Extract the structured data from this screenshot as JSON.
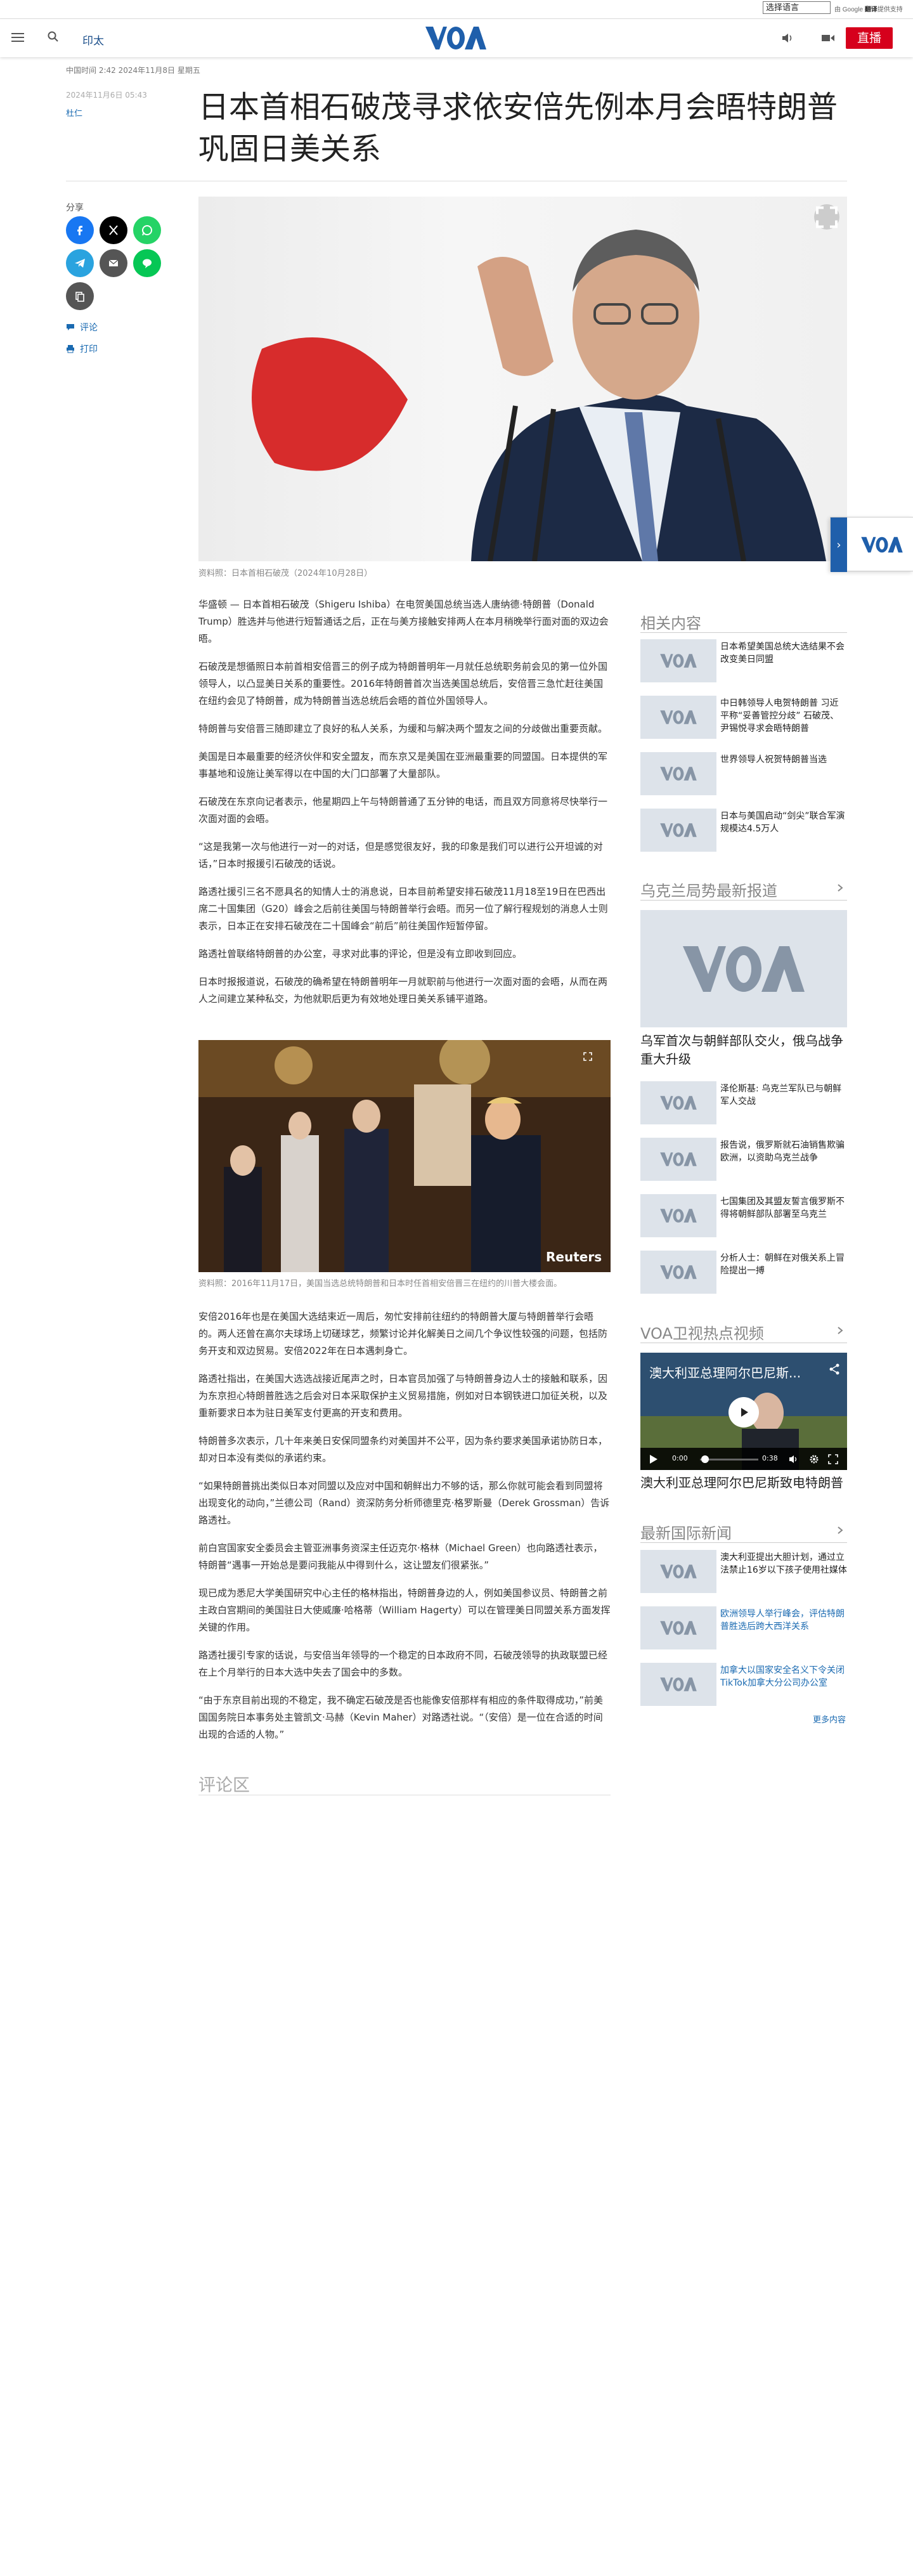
{
  "translate": {
    "select_label": "选择语言",
    "powered_prefix": "由",
    "powered_google": "Google",
    "powered_suffix": "翻译",
    "powered_tail": "提供支持"
  },
  "header": {
    "print_label": "印太",
    "live_label": "直播",
    "logo_text": "VOA"
  },
  "article": {
    "published": "中国时间 2:42 2024年11月8日 星期五",
    "posted": "2024年11月6日 05:43",
    "author": "杜仁",
    "title": "日本首相石破茂寻求依安倍先例本月会晤特朗普巩固日美关系",
    "share_label": "分享",
    "comments_link": "评论",
    "print_link": "打印",
    "hero_caption": "资料照：日本首相石破茂（2024年10月28日）",
    "paragraphs_a": [
      "华盛顿 — 日本首相石破茂（Shigeru Ishiba）在电贺美国总统当选人唐纳德·特朗普（Donald Trump）胜选并与他进行短暂通话之后，正在与美方接触安排两人在本月稍晚举行面对面的双边会晤。",
      "石破茂是想循照日本前首相安倍晋三的例子成为特朗普明年一月就任总统职务前会见的第一位外国领导人，以凸显美日关系的重要性。2016年特朗普首次当选美国总统后，安倍晋三急忙赶往美国在纽约会见了特朗普，成为特朗普当选总统后会晤的首位外国领导人。",
      "特朗普与安倍晋三随即建立了良好的私人关系，为缓和与解决两个盟友之间的分歧做出重要贡献。",
      "美国是日本最重要的经济伙伴和安全盟友，而东京又是美国在亚洲最重要的同盟国。日本提供的军事基地和设施让美军得以在中国的大门口部署了大量部队。",
      "石破茂在东京向记者表示，他星期四上午与特朗普通了五分钟的电话，而且双方同意将尽快举行一次面对面的会晤。",
      "“这是我第一次与他进行一对一的对话，但是感觉很友好，我的印象是我们可以进行公开坦诚的对话，”日本时报援引石破茂的话说。",
      "路透社援引三名不愿具名的知情人士的消息说，日本目前希望安排石破茂11月18至19日在巴西出席二十国集团（G20）峰会之后前往美国与特朗普举行会晤。而另一位了解行程规划的消息人士则表示，日本正在安排石破茂在二十国峰会“前后”前往美国作短暂停留。",
      "路透社曾联络特朗普的办公室，寻求对此事的评论，但是没有立即收到回应。",
      "日本时报报道说，石破茂的确希望在特朗普明年一月就职前与他进行一次面对面的会晤，从而在两人之间建立某种私交，为他就职后更为有效地处理日美关系铺平道路。"
    ],
    "inline_caption": "资料照：2016年11月17日，美国当选总统特朗普和日本时任首相安倍晋三在纽约的川普大楼会面。",
    "inline_watermark": "Reuters",
    "paragraphs_b": [
      "安倍2016年也是在美国大选结束近一周后，匆忙安排前往纽约的特朗普大厦与特朗普举行会晤的。两人还曾在高尔夫球场上切磋球艺，频繁讨论并化解美日之间几个争议性较强的问题，包括防务开支和双边贸易。安倍2022年在日本遇刺身亡。",
      "路透社指出，在美国大选选战接近尾声之时，日本官员加强了与特朗普身边人士的接触和联系，因为东京担心特朗普胜选之后会对日本采取保护主义贸易措施，例如对日本钢铁进口加征关税，以及重新要求日本为驻日美军支付更高的开支和费用。",
      "特朗普多次表示，几十年来美日安保同盟条约对美国并不公平，因为条约要求美国承诺协防日本，却对日本没有类似的承诺约束。",
      "“如果特朗普挑出类似日本对同盟以及应对中国和朝鲜出力不够的话，那么你就可能会看到同盟将出现变化的动向，”兰德公司（Rand）资深防务分析师德里克·格罗斯曼（Derek Grossman）告诉路透社。",
      "前白宫国家安全委员会主管亚洲事务资深主任迈克尔·格林（Michael Green）也向路透社表示，特朗普“遇事一开始总是要问我能从中得到什么，这让盟友们很紧张。”",
      "现已成为悉尼大学美国研究中心主任的格林指出，特朗普身边的人，例如美国参议员、特朗普之前主政白宫期间的美国驻日大使威廉·哈格蒂（William Hagerty）可以在管理美日同盟关系方面发挥关键的作用。",
      "路透社援引专家的话说，与安倍当年领导的一个稳定的日本政府不同，石破茂领导的执政联盟已经在上个月举行的日本大选中失去了国会中的多数。",
      "“由于东京目前出现的不稳定，我不确定石破茂是否也能像安倍那样有相应的条件取得成功，”前美国国务院日本事务处主管凯文·马赫（Kevin Maher）对路透社说。“（安倍）是一位在合适的时间出现的合适的人物。”"
    ],
    "comments_heading": "评论区"
  },
  "sidebar": {
    "related_heading": "相关内容",
    "related": [
      "日本希望美国总统大选结果不会改变美日同盟",
      "中日韩领导人电贺特朗普 习近平称“妥善管控分歧” 石破茂、尹锡悦寻求会晤特朗普",
      "世界领导人祝贺特朗普当选",
      "日本与美国启动“剑尖”联合军演 规模达4.5万人"
    ],
    "ukraine_heading": "乌克兰局势最新报道",
    "ukraine_feature": "乌军首次与朝鲜部队交火，俄乌战争重大升级",
    "ukraine": [
      "泽伦斯基: 乌克兰军队已与朝鲜军人交战",
      "报告说，俄罗斯就石油销售欺骗欧洲，以资助乌克兰战争",
      "七国集团及其盟友誓言俄罗斯不得将朝鲜部队部署至乌克兰",
      "分析人士：朝鲜在对俄关系上冒险提出一搏"
    ],
    "video_heading": "VOA卫视热点视频",
    "video_title": "澳大利亚总理阿尔巴尼斯...",
    "video_time_current": "0:00",
    "video_time_total": "0:38",
    "video_caption": "澳大利亚总理阿尔巴尼斯致电特朗普",
    "intl_heading": "最新国际新闻",
    "intl": [
      "澳大利亚提出大胆计划，通过立法禁止16岁以下孩子使用社媒体",
      "欧洲领导人举行峰会，评估特朗普胜选后跨大西洋关系",
      "加拿大以国家安全名义下令关闭TikTok加拿大分公司办公室"
    ],
    "more_label": "更多内容"
  },
  "colors": {
    "brand_blue": "#1f5fab",
    "live_red": "#d6001c",
    "link_blue": "#1a6ab1"
  }
}
